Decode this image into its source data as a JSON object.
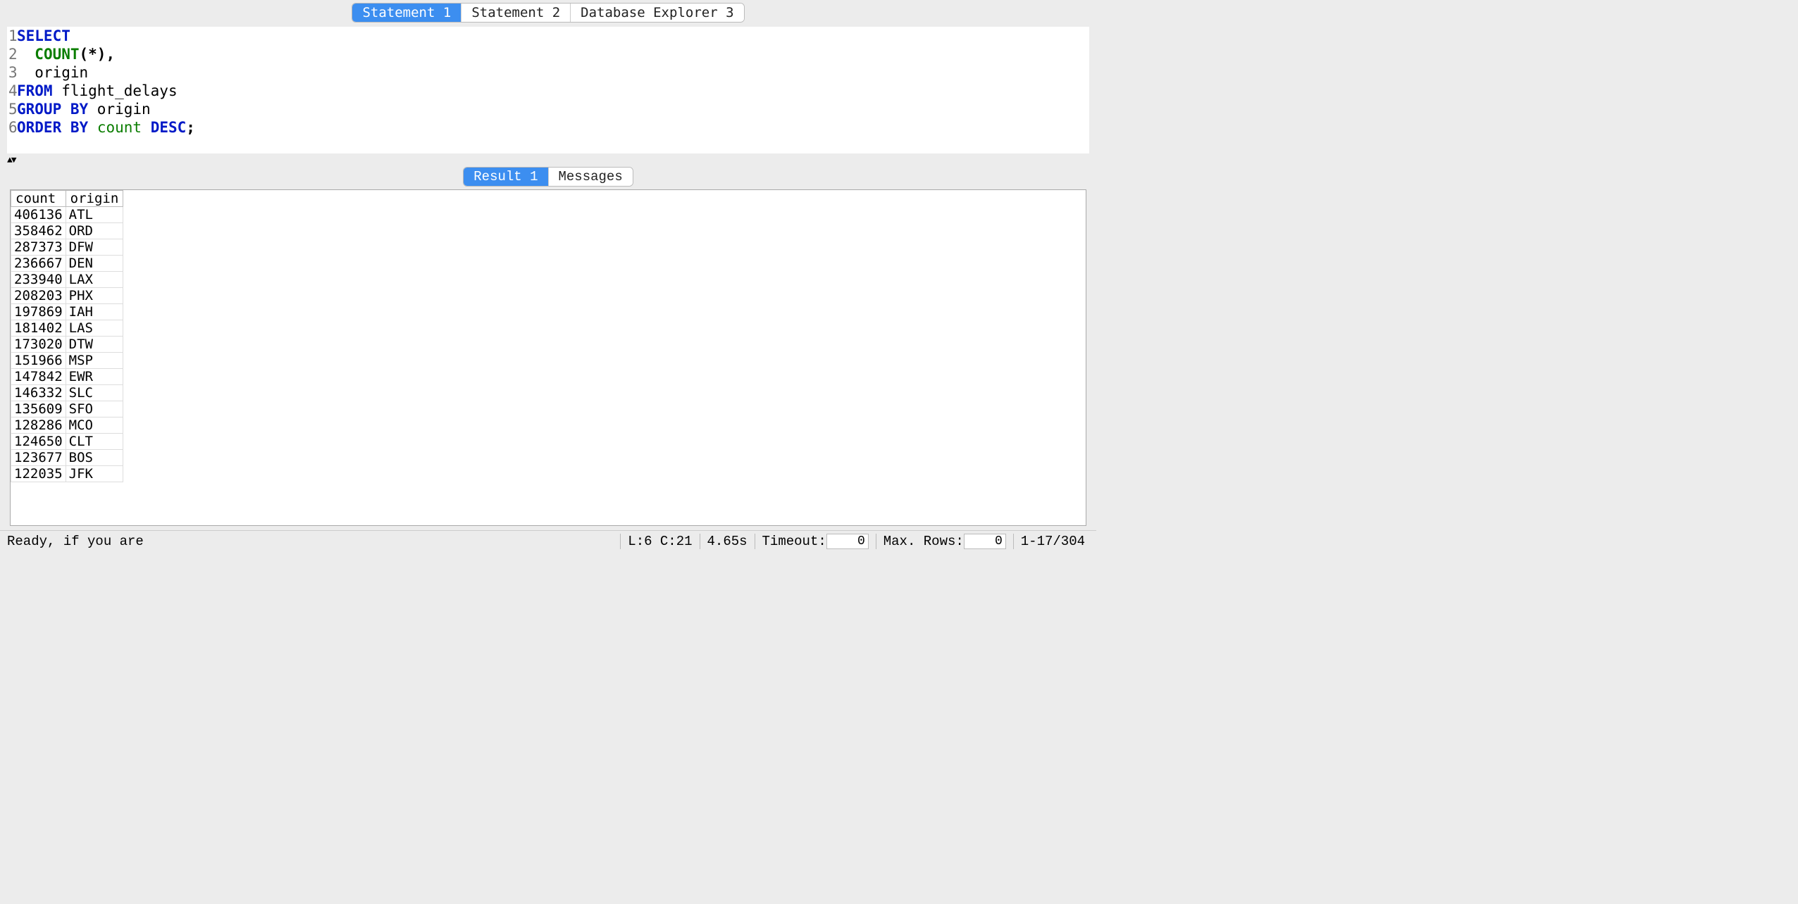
{
  "tabs": {
    "items": [
      {
        "label": "Statement 1",
        "active": true
      },
      {
        "label": "Statement 2",
        "active": false
      },
      {
        "label": "Database Explorer 3",
        "active": false
      }
    ]
  },
  "editor": {
    "lines": [
      {
        "num": "1",
        "tokens": [
          {
            "t": "SELECT",
            "c": "kw"
          }
        ]
      },
      {
        "num": "2",
        "tokens": [
          {
            "t": "  ",
            "c": "plain"
          },
          {
            "t": "COUNT",
            "c": "fn"
          },
          {
            "t": "(*),",
            "c": "black-bold"
          }
        ]
      },
      {
        "num": "3",
        "tokens": [
          {
            "t": "  origin",
            "c": "plain"
          }
        ]
      },
      {
        "num": "4",
        "tokens": [
          {
            "t": "FROM",
            "c": "kw"
          },
          {
            "t": " flight_delays",
            "c": "plain"
          }
        ]
      },
      {
        "num": "5",
        "tokens": [
          {
            "t": "GROUP BY",
            "c": "kw"
          },
          {
            "t": " origin",
            "c": "plain"
          }
        ]
      },
      {
        "num": "6",
        "tokens": [
          {
            "t": "ORDER BY",
            "c": "kw"
          },
          {
            "t": " ",
            "c": "plain"
          },
          {
            "t": "count",
            "c": "id"
          },
          {
            "t": " ",
            "c": "plain"
          },
          {
            "t": "DESC",
            "c": "kw"
          },
          {
            "t": ";",
            "c": "black-bold"
          }
        ]
      }
    ]
  },
  "result_tabs": {
    "items": [
      {
        "label": "Result 1",
        "active": true
      },
      {
        "label": "Messages",
        "active": false
      }
    ]
  },
  "results": {
    "columns": [
      "count",
      "origin"
    ],
    "rows": [
      {
        "count": "406136",
        "origin": "ATL"
      },
      {
        "count": "358462",
        "origin": "ORD"
      },
      {
        "count": "287373",
        "origin": "DFW"
      },
      {
        "count": "236667",
        "origin": "DEN"
      },
      {
        "count": "233940",
        "origin": "LAX"
      },
      {
        "count": "208203",
        "origin": "PHX"
      },
      {
        "count": "197869",
        "origin": "IAH"
      },
      {
        "count": "181402",
        "origin": "LAS"
      },
      {
        "count": "173020",
        "origin": "DTW"
      },
      {
        "count": "151966",
        "origin": "MSP"
      },
      {
        "count": "147842",
        "origin": "EWR"
      },
      {
        "count": "146332",
        "origin": "SLC"
      },
      {
        "count": "135609",
        "origin": "SFO"
      },
      {
        "count": "128286",
        "origin": "MCO"
      },
      {
        "count": "124650",
        "origin": "CLT"
      },
      {
        "count": "123677",
        "origin": "BOS"
      },
      {
        "count": "122035",
        "origin": "JFK"
      }
    ]
  },
  "statusbar": {
    "message": "Ready, if you are",
    "cursor": "L:6 C:21",
    "time": "4.65s",
    "timeout_label": "Timeout:",
    "timeout_value": "0",
    "maxrows_label": "Max. Rows:",
    "maxrows_value": "0",
    "range": "1-17/304"
  }
}
